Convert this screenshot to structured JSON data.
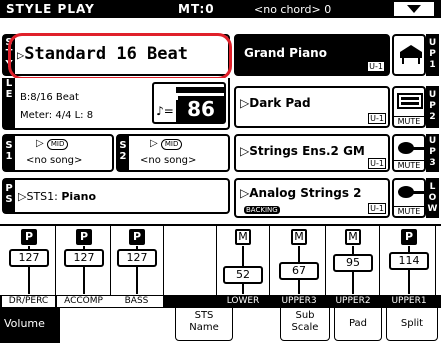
{
  "header": {
    "title": "STYLE PLAY",
    "mt": "MT:0",
    "chord": "<no chord> 0"
  },
  "style": {
    "tab_letters": [
      "S",
      "T",
      "Y",
      "L",
      "E"
    ],
    "name": "Standard 16 Beat",
    "meter_line1": "B:8/16 Beat",
    "meter_line2": "Meter: 4/4  L: 8",
    "tempo": "86",
    "tempo_note": "♪="
  },
  "songs": [
    {
      "tab": "S1",
      "midi": "MID",
      "value": "<no song>"
    },
    {
      "tab": "S2",
      "midi": "MID",
      "value": "<no song>"
    }
  ],
  "sts": {
    "tab": "PS",
    "label": "STS1:",
    "name": "Piano"
  },
  "sounds": [
    {
      "name": "Grand Piano",
      "badge": "U-1",
      "selected": true,
      "side": "UP 1",
      "icon": "piano-icon",
      "mute": ""
    },
    {
      "name": "Dark Pad",
      "badge": "U-1",
      "selected": false,
      "side": "UP 2",
      "icon": "synth-icon",
      "mute": "MUTE"
    },
    {
      "name": "Strings Ens.2 GM",
      "badge": "U-1",
      "selected": false,
      "side": "UP 3",
      "icon": "strings-icon",
      "mute": "MUTE"
    },
    {
      "name": "Analog Strings 2",
      "badge": "U-1",
      "selected": false,
      "side": "LOW",
      "icon": "strings-icon",
      "mute": "MUTE",
      "backing": "BACKING"
    }
  ],
  "mixer": {
    "channels": [
      {
        "name": "DR/PERC",
        "type": "P",
        "value": "127"
      },
      {
        "name": "ACCOMP",
        "type": "P",
        "value": "127"
      },
      {
        "name": "BASS",
        "type": "P",
        "value": "127"
      },
      {
        "name": "",
        "type": "",
        "value": ""
      },
      {
        "name": "LOWER",
        "type": "M",
        "value": "52"
      },
      {
        "name": "UPPER3",
        "type": "M",
        "value": "67"
      },
      {
        "name": "UPPER2",
        "type": "M",
        "value": "95"
      },
      {
        "name": "UPPER1",
        "type": "P",
        "value": "114"
      }
    ]
  },
  "tabs": [
    "Volume",
    "STS Name",
    "Sub Scale",
    "Pad",
    "Split"
  ]
}
